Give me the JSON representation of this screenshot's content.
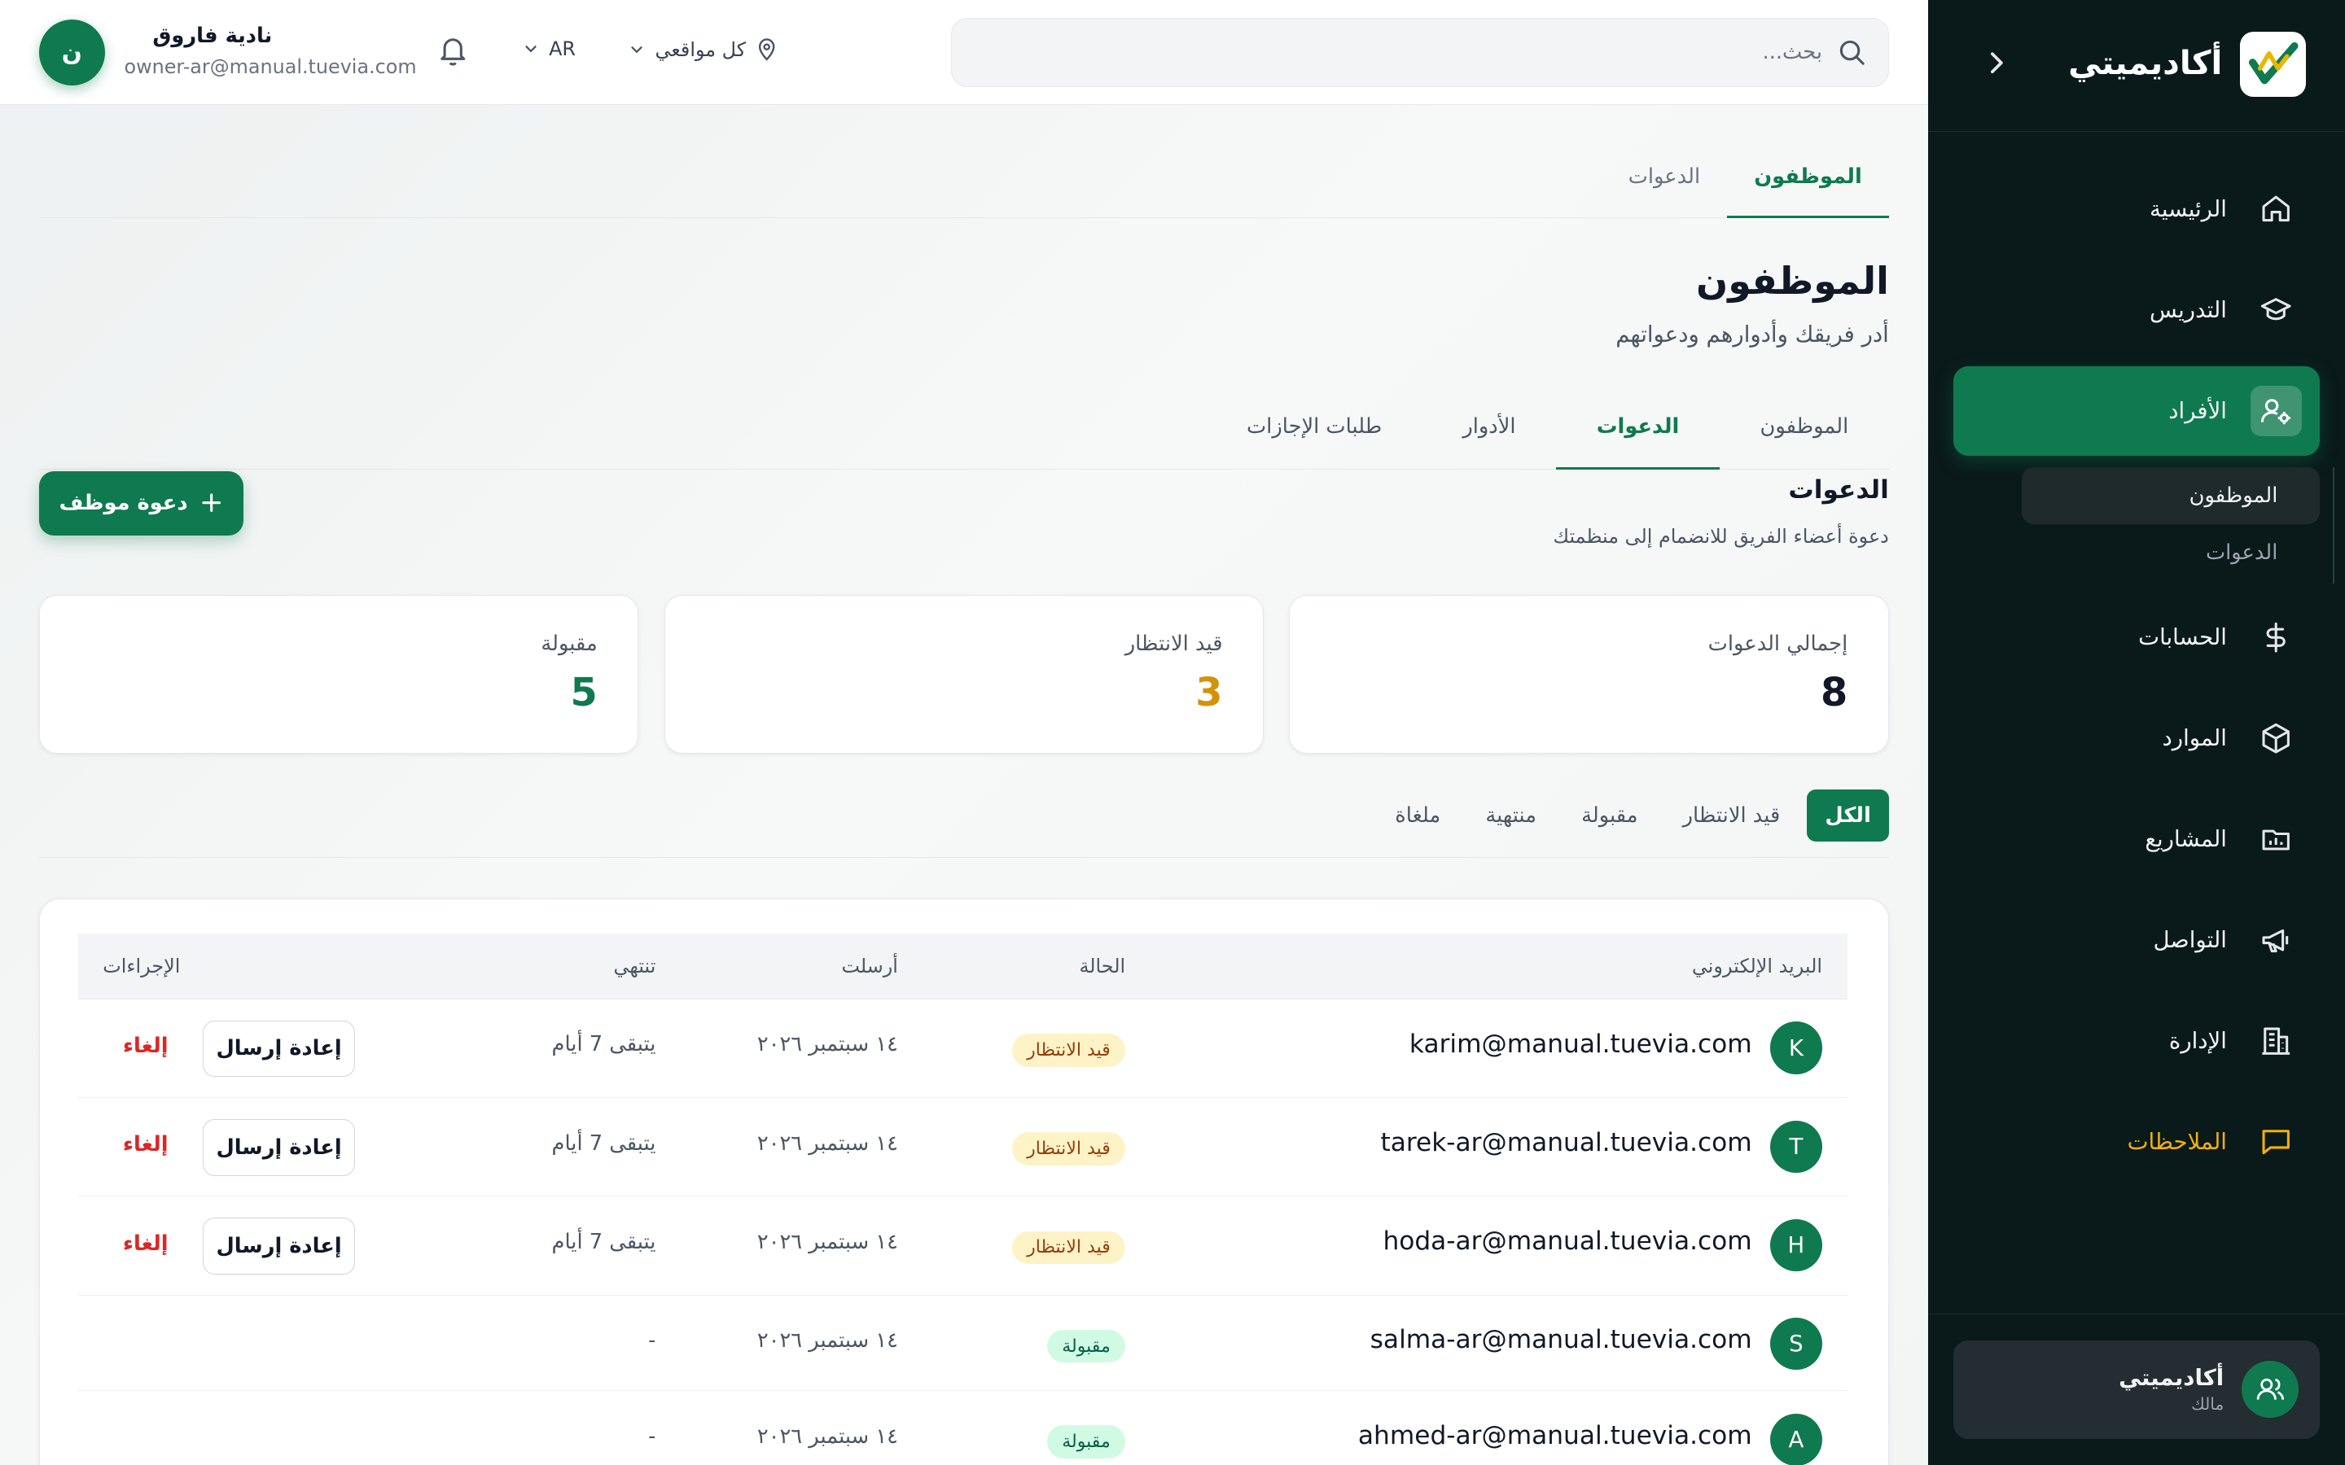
{
  "colors": {
    "primary": "#0f7a4f",
    "sidebar_bg": "#0a1a1a",
    "pending_value": "#d4920a",
    "accepted_value": "#0f7a4f",
    "danger": "#dc2626",
    "notes": "#f5b10b"
  },
  "sidebar": {
    "brand": "أكاديميتي",
    "items": [
      {
        "label": "الرئيسية",
        "icon": "home-icon"
      },
      {
        "label": "التدريس",
        "icon": "graduation-cap-icon"
      },
      {
        "label": "الأفراد",
        "icon": "user-cog-icon",
        "active": true
      },
      {
        "label": "الحسابات",
        "icon": "dollar-icon"
      },
      {
        "label": "الموارد",
        "icon": "box-icon"
      },
      {
        "label": "المشاريع",
        "icon": "folder-chart-icon"
      },
      {
        "label": "التواصل",
        "icon": "megaphone-icon"
      },
      {
        "label": "الإدارة",
        "icon": "building-icon"
      },
      {
        "label": "الملاحظات",
        "icon": "message-square-icon"
      }
    ],
    "sub_items": [
      {
        "label": "الموظفون",
        "active": true
      },
      {
        "label": "الدعوات"
      }
    ],
    "org": {
      "name": "أكاديميتي",
      "role": "مالك"
    }
  },
  "topbar": {
    "search_placeholder": "بحث...",
    "location": "كل مواقعي",
    "language": "AR",
    "user_name": "نادية فاروق",
    "user_email": "owner-ar@manual.tuevia.com",
    "avatar_initial": "ن"
  },
  "main": {
    "top_tabs": [
      {
        "label": "الموظفون",
        "active": true
      },
      {
        "label": "الدعوات"
      }
    ],
    "title": "الموظفون",
    "subtitle": "أدر فريقك وأدوارهم ودعواتهم",
    "sub_tabs": [
      {
        "label": "الموظفون"
      },
      {
        "label": "الدعوات",
        "active": true
      },
      {
        "label": "الأدوار"
      },
      {
        "label": "طلبات الإجازات"
      }
    ],
    "section_title": "الدعوات",
    "section_subtitle": "دعوة أعضاء الفريق للانضمام إلى منظمتك",
    "invite_button": "دعوة موظف",
    "stats": [
      {
        "label": "إجمالي الدعوات",
        "value": "8"
      },
      {
        "label": "قيد الانتظار",
        "value": "3"
      },
      {
        "label": "مقبولة",
        "value": "5"
      }
    ],
    "filters": [
      {
        "label": "الكل",
        "active": true
      },
      {
        "label": "قيد الانتظار"
      },
      {
        "label": "مقبولة"
      },
      {
        "label": "منتهية"
      },
      {
        "label": "ملغاة"
      }
    ],
    "table": {
      "headers": {
        "email": "البريد الإلكتروني",
        "status": "الحالة",
        "sent": "أرسلت",
        "expires": "تنتهي",
        "actions": "الإجراءات"
      },
      "resend_label": "إعادة إرسال",
      "cancel_label": "إلغاء",
      "rows": [
        {
          "initial": "K",
          "email": "karim@manual.tuevia.com",
          "status": "قيد الانتظار",
          "status_kind": "pending",
          "sent": "١٤ سبتمبر ٢٠٢٦",
          "expires": "يتبقى 7 أيام",
          "actions": true
        },
        {
          "initial": "T",
          "email": "tarek-ar@manual.tuevia.com",
          "status": "قيد الانتظار",
          "status_kind": "pending",
          "sent": "١٤ سبتمبر ٢٠٢٦",
          "expires": "يتبقى 7 أيام",
          "actions": true
        },
        {
          "initial": "H",
          "email": "hoda-ar@manual.tuevia.com",
          "status": "قيد الانتظار",
          "status_kind": "pending",
          "sent": "١٤ سبتمبر ٢٠٢٦",
          "expires": "يتبقى 7 أيام",
          "actions": true
        },
        {
          "initial": "S",
          "email": "salma-ar@manual.tuevia.com",
          "status": "مقبولة",
          "status_kind": "accepted",
          "sent": "١٤ سبتمبر ٢٠٢٦",
          "expires": "-",
          "actions": false
        },
        {
          "initial": "A",
          "email": "ahmed-ar@manual.tuevia.com",
          "status": "مقبولة",
          "status_kind": "accepted",
          "sent": "١٤ سبتمبر ٢٠٢٦",
          "expires": "-",
          "actions": false
        }
      ]
    }
  }
}
